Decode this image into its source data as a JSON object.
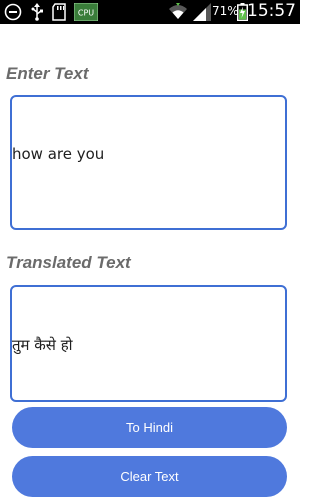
{
  "status_bar": {
    "battery_percent": "71%",
    "time": "15:57",
    "left_icons": [
      "minus-circle-icon",
      "usb-icon",
      "sd-card-icon",
      "cpu-icon"
    ],
    "cpu_label": "CPU",
    "right_icons": [
      "wifi-icon",
      "signal-icon",
      "battery-icon"
    ]
  },
  "labels": {
    "enter_text": "Enter Text",
    "translated_text": "Translated Text"
  },
  "input": {
    "value": "how are you"
  },
  "output": {
    "value": "तुम कैसे हो"
  },
  "buttons": {
    "to_hindi": "To Hindi",
    "clear_text": "Clear Text"
  },
  "colors": {
    "accent": "#4f79dd",
    "border": "#3f6fd4",
    "label": "#6b6b6b"
  }
}
